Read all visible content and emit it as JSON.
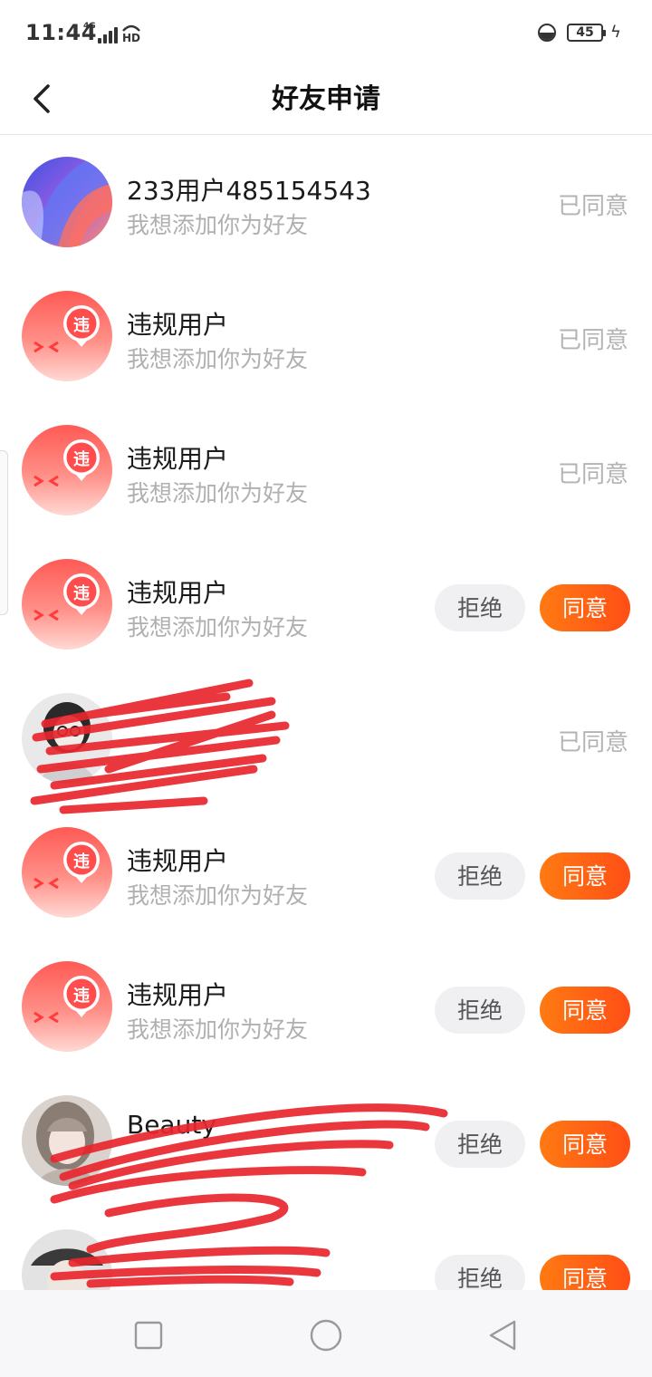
{
  "status_bar": {
    "time": "11:44",
    "network": "4G",
    "hd": "HD",
    "battery": "45"
  },
  "header": {
    "title": "好友申请"
  },
  "requests": [
    {
      "name": "233用户485154543",
      "message": "我想添加你为好友",
      "status": "已同意",
      "avatar": "abstract"
    },
    {
      "name": "违规用户",
      "message": "我想添加你为好友",
      "status": "已同意",
      "avatar": "violation"
    },
    {
      "name": "违规用户",
      "message": "我想添加你为好友",
      "status": "已同意",
      "avatar": "violation"
    },
    {
      "name": "违规用户",
      "message": "我想添加你为好友",
      "reject": "拒绝",
      "accept": "同意",
      "avatar": "violation"
    },
    {
      "name": "",
      "message": "",
      "status": "已同意",
      "avatar": "photo-redacted"
    },
    {
      "name": "违规用户",
      "message": "我想添加你为好友",
      "reject": "拒绝",
      "accept": "同意",
      "avatar": "violation"
    },
    {
      "name": "违规用户",
      "message": "我想添加你为好友",
      "reject": "拒绝",
      "accept": "同意",
      "avatar": "violation"
    },
    {
      "name": "Beauty",
      "message": "",
      "reject": "拒绝",
      "accept": "同意",
      "avatar": "photo-redacted"
    },
    {
      "name": "",
      "message": "",
      "reject": "拒绝",
      "accept": "同意",
      "avatar": "photo-redacted"
    }
  ],
  "violation_badge": "违",
  "colors": {
    "accent": "#ff5a14",
    "violation_red": "#ff5a5a",
    "scribble": "#e8262c"
  },
  "icons": {
    "back": "chevron-left-icon",
    "nav_recent": "square-icon",
    "nav_home": "circle-icon",
    "nav_back": "triangle-left-icon"
  }
}
